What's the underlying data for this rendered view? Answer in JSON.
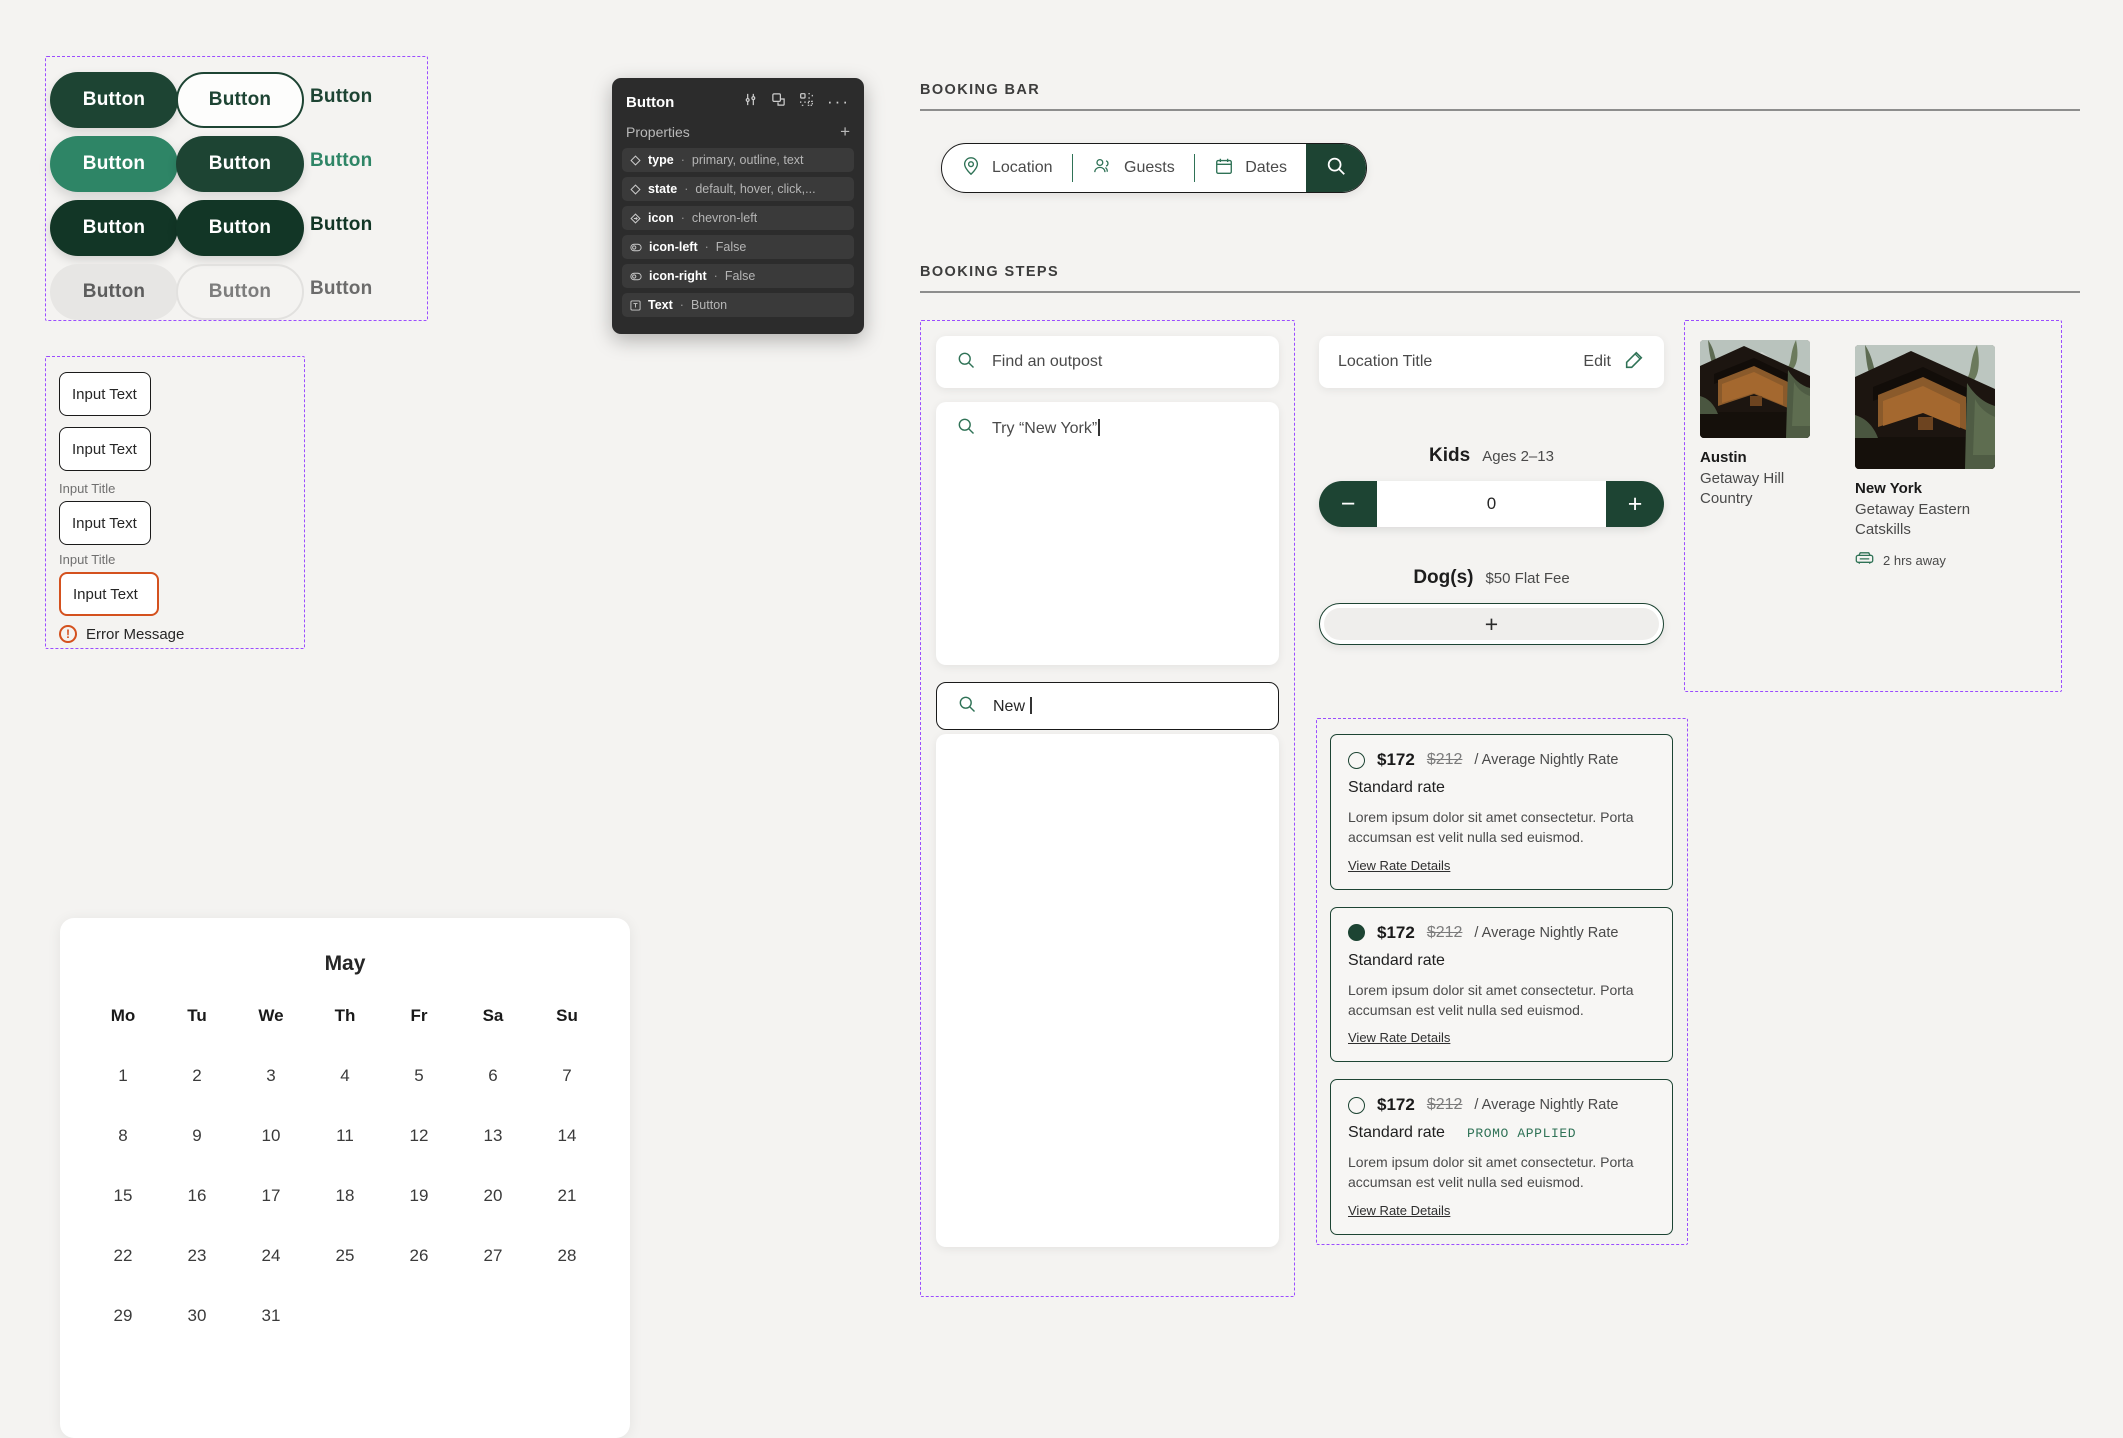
{
  "buttons": {
    "rows": [
      {
        "state": "default",
        "primary": "Button",
        "outline": "Button",
        "text": "Button"
      },
      {
        "state": "hover",
        "primary": "Button",
        "outline": "Button",
        "text": "Button"
      },
      {
        "state": "click",
        "primary": "Button",
        "outline": "Button",
        "text": "Button"
      },
      {
        "state": "disabled",
        "primary": "Button",
        "outline": "Button",
        "text": "Button"
      }
    ]
  },
  "inputs": {
    "field1": {
      "value": "Input Text"
    },
    "field2": {
      "value": "Input Text"
    },
    "field3": {
      "label": "Input Title",
      "value": "Input Text"
    },
    "field4": {
      "label": "Input Title",
      "value": "Input Text",
      "error": "Error Message"
    }
  },
  "calendar": {
    "month": "May",
    "dow": [
      "Mo",
      "Tu",
      "We",
      "Th",
      "Fr",
      "Sa",
      "Su"
    ],
    "days": [
      1,
      2,
      3,
      4,
      5,
      6,
      7,
      8,
      9,
      10,
      11,
      12,
      13,
      14,
      15,
      16,
      17,
      18,
      19,
      20,
      21,
      22,
      23,
      24,
      25,
      26,
      27,
      28,
      29,
      30,
      31
    ]
  },
  "properties_panel": {
    "title": "Button",
    "subtitle": "Properties",
    "rows": [
      {
        "icon": "variant-diamond-icon",
        "name": "type",
        "sep": "·",
        "value": "primary, outline, text"
      },
      {
        "icon": "variant-diamond-icon",
        "name": "state",
        "sep": "·",
        "value": "default, hover, click,..."
      },
      {
        "icon": "instance-swap-icon",
        "name": "icon",
        "sep": "·",
        "value": "chevron-left"
      },
      {
        "icon": "boolean-toggle-icon",
        "name": "icon-left",
        "sep": "·",
        "value": "False"
      },
      {
        "icon": "boolean-toggle-icon",
        "name": "icon-right",
        "sep": "·",
        "value": "False"
      },
      {
        "icon": "text-property-icon",
        "name": "Text",
        "sep": "·",
        "value": "Button"
      }
    ]
  },
  "booking_bar": {
    "section_label": "BOOKING BAR",
    "items": [
      {
        "icon": "map-pin-icon",
        "label": "Location"
      },
      {
        "icon": "guests-icon",
        "label": "Guests"
      },
      {
        "icon": "calendar-icon",
        "label": "Dates"
      }
    ],
    "search_icon": "search-icon"
  },
  "booking_steps": {
    "section_label": "BOOKING STEPS",
    "search_find": {
      "icon": "search-icon",
      "placeholder": "Find an outpost"
    },
    "search_try": {
      "icon": "search-icon",
      "value": "Try “New York”"
    },
    "search_new": {
      "icon": "search-icon",
      "value": "New "
    },
    "location_title": {
      "label": "Location Title",
      "edit_label": "Edit",
      "edit_icon": "edit-pencil-icon"
    },
    "kids": {
      "label": "Kids",
      "sub": "Ages 2–13",
      "value": "0",
      "minus": "−",
      "plus": "+"
    },
    "dogs": {
      "label": "Dog(s)",
      "sub": "$50 Flat Fee",
      "add": "+"
    }
  },
  "locations": [
    {
      "name": "Austin",
      "desc": "Getaway Hill Country",
      "away": null,
      "away_icon": null
    },
    {
      "name": "New York",
      "desc": "Getaway Eastern Catskills",
      "away": "2 hrs away",
      "away_icon": "car-icon"
    }
  ],
  "rates": [
    {
      "selected": false,
      "price": "$172",
      "old_price": "$212",
      "per": "/ Average Nightly Rate",
      "name": "Standard rate",
      "promo": null,
      "desc": "Lorem ipsum dolor sit amet consectetur. Porta accumsan est velit nulla sed euismod.",
      "link": "View Rate Details"
    },
    {
      "selected": true,
      "price": "$172",
      "old_price": "$212",
      "per": "/ Average Nightly Rate",
      "name": "Standard rate",
      "promo": null,
      "desc": "Lorem ipsum dolor sit amet consectetur. Porta accumsan est velit nulla sed euismod.",
      "link": "View Rate Details"
    },
    {
      "selected": false,
      "price": "$172",
      "old_price": "$212",
      "per": "/ Average Nightly Rate",
      "name": "Standard rate",
      "promo": "PROMO APPLIED",
      "desc": "Lorem ipsum dolor sit amet consectetur. Porta accumsan est velit nulla sed euismod.",
      "link": "View Rate Details"
    }
  ],
  "colors": {
    "background": "#f4f3f1",
    "green_dark": "#1d4433",
    "green_darkest": "#123626",
    "green_mid": "#2e8566",
    "orange": "#d4511e",
    "spec_purple": "#9b4dff"
  }
}
